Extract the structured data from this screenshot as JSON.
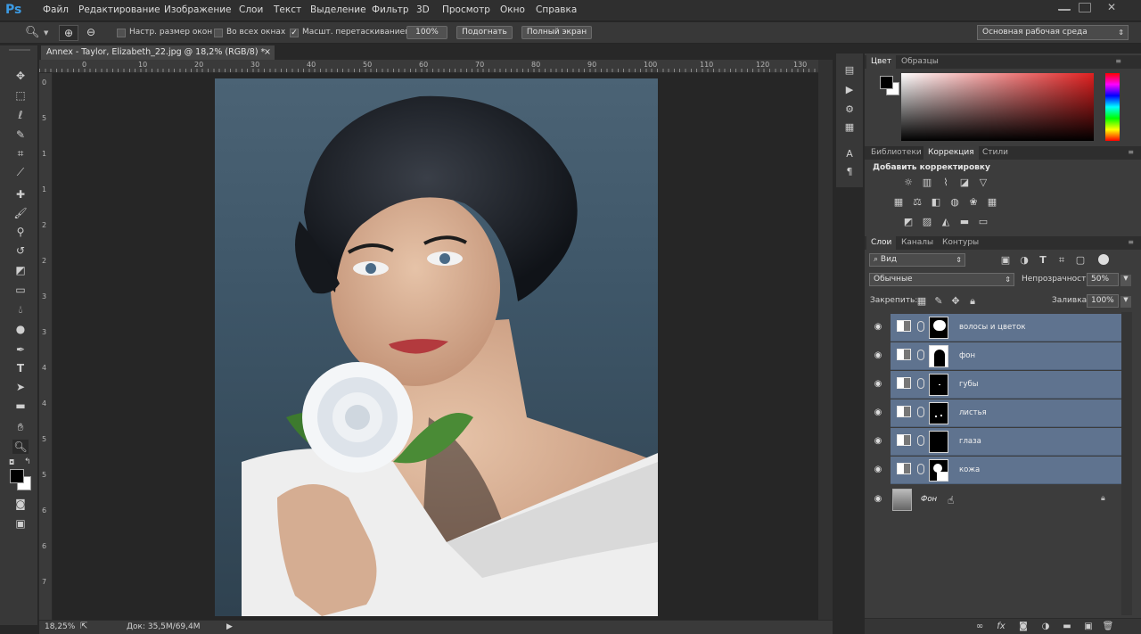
{
  "app": {
    "logo": "Ps"
  },
  "menu": [
    "Файл",
    "Редактирование",
    "Изображение",
    "Слои",
    "Текст",
    "Выделение",
    "Фильтр",
    "3D",
    "Просмотр",
    "Окно",
    "Справка"
  ],
  "options": {
    "resize_windows": "Настр. размер окон",
    "all_windows": "Во всех окнах",
    "scrubby_zoom": "Масшт. перетаскиванием",
    "zoom100": "100%",
    "fit": "Подогнать",
    "fullscreen": "Полный экран",
    "workspace": "Основная рабочая среда",
    "scrubby_checked": true
  },
  "document": {
    "tab": "Annex - Taylor, Elizabeth_22.jpg @ 18,2% (RGB/8) *",
    "close": "×",
    "ruler_h": [
      "0",
      "10",
      "20",
      "30",
      "40",
      "50",
      "60",
      "70",
      "80",
      "90",
      "100",
      "110",
      "120",
      "130"
    ],
    "ruler_v": [
      "0",
      "5",
      "1",
      "1",
      "2",
      "2",
      "3",
      "3",
      "4",
      "4",
      "5",
      "5",
      "6",
      "6",
      "7"
    ]
  },
  "status": {
    "zoom": "18,25%",
    "doc": "Док: 35,5M/69,4M",
    "arrow": "▶"
  },
  "color_panel": {
    "tabs": [
      "Цвет",
      "Образцы"
    ],
    "fg": "#000000",
    "bg": "#ffffff"
  },
  "adjust_panel": {
    "tabs": [
      "Библиотеки",
      "Коррекция",
      "Стили"
    ],
    "title": "Добавить корректировку"
  },
  "layers_panel": {
    "tabs": [
      "Слои",
      "Каналы",
      "Контуры"
    ],
    "filter": "Вид",
    "blend": "Обычные",
    "opacity_label": "Непрозрачность:",
    "opacity": "50%",
    "lock_label": "Закрепить:",
    "fill_label": "Заливка:",
    "fill": "100%",
    "layers": [
      {
        "name": "волосы и цветок",
        "selected": true
      },
      {
        "name": "фон",
        "selected": true
      },
      {
        "name": "губы",
        "selected": true
      },
      {
        "name": "листья",
        "selected": true
      },
      {
        "name": "глаза",
        "selected": true
      },
      {
        "name": "кожа",
        "selected": true
      }
    ],
    "background": {
      "name": "Фон"
    }
  },
  "icons": {
    "tools": [
      "move-icon",
      "marquee-icon",
      "lasso-icon",
      "quick-select-icon",
      "crop-icon",
      "eyedropper-icon",
      "healing-icon",
      "brush-icon",
      "stamp-icon",
      "history-brush-icon",
      "eraser-icon",
      "gradient-icon",
      "blur-icon",
      "dodge-icon",
      "pen-icon",
      "type-icon",
      "path-select-icon",
      "shape-icon",
      "hand-icon",
      "zoom-icon"
    ]
  }
}
